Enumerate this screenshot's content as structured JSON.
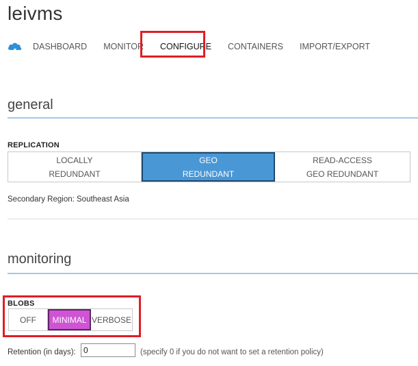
{
  "page": {
    "title": "leivms"
  },
  "nav": {
    "tabs": [
      {
        "label": "DASHBOARD"
      },
      {
        "label": "MONITOR"
      },
      {
        "label": "CONFIGURE"
      },
      {
        "label": "CONTAINERS"
      },
      {
        "label": "IMPORT/EXPORT"
      }
    ],
    "active": "CONFIGURE",
    "logo_icon": "storage-cloud-icon"
  },
  "general": {
    "title": "general",
    "replication": {
      "label": "REPLICATION",
      "options": [
        {
          "line1": "LOCALLY",
          "line2": "REDUNDANT"
        },
        {
          "line1": "GEO",
          "line2": "REDUNDANT"
        },
        {
          "line1": "READ-ACCESS",
          "line2": "GEO REDUNDANT"
        }
      ],
      "selected": "GEO REDUNDANT"
    },
    "secondary_region": "Secondary Region: Southeast Asia"
  },
  "monitoring": {
    "title": "monitoring",
    "blobs": {
      "label": "BLOBS",
      "options": [
        "OFF",
        "MINIMAL",
        "VERBOSE"
      ],
      "selected": "MINIMAL"
    },
    "retention": {
      "label": "Retention (in days):",
      "value": "0",
      "hint": "(specify 0 if you do not want to set a retention policy)"
    }
  },
  "colors": {
    "accent_blue": "#4a97d6",
    "selected_purple": "#cf54d4",
    "highlight_red": "#e01d24",
    "section_rule": "#a5c6e8"
  }
}
